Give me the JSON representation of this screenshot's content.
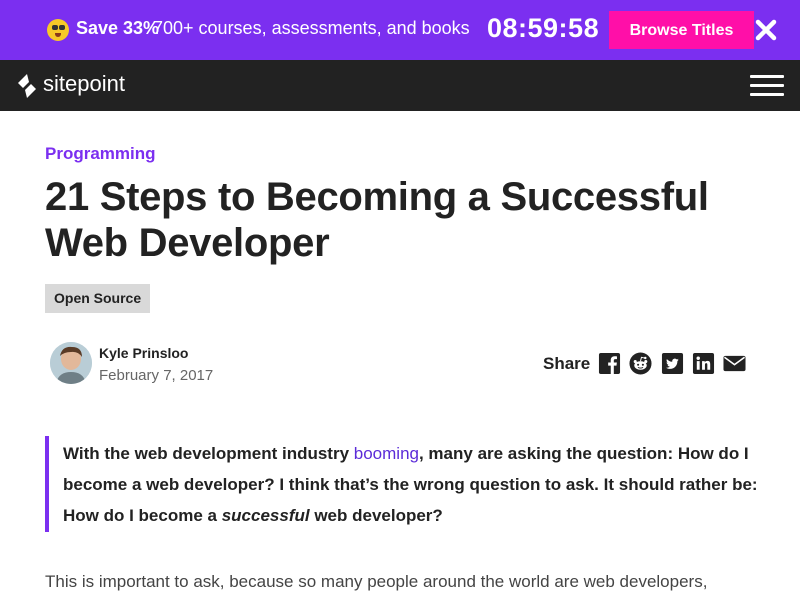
{
  "promo": {
    "save": "Save 33%",
    "text": "700+ courses, assessments, and books",
    "timer": "08:59:58",
    "button_label": "Browse Titles",
    "icon": "astonished-face-emoji"
  },
  "nav": {
    "logo_text": "sitepoint"
  },
  "article": {
    "category": "Programming",
    "title": "21 Steps to Becoming a Successful Web Developer",
    "tag": "Open Source",
    "author": "Kyle Prinsloo",
    "date": "February 7, 2017",
    "share_label": "Share",
    "share_icons": [
      "facebook-icon",
      "reddit-icon",
      "twitter-icon",
      "linkedin-icon",
      "email-icon"
    ],
    "lead": {
      "before_link": "With the web development industry ",
      "link": "booming",
      "middle": ", many are asking the question: How do I become a web developer? I think that’s the wrong question to ask. It should rather be: How do I become a ",
      "emphasis": "successful",
      "after": " web developer?"
    },
    "body_first_line": "This is important to ask, because so many people around the world are web developers,"
  },
  "colors": {
    "accent": "#7b2ff0",
    "cta": "#ff0fa8",
    "nav_bg": "#222222"
  }
}
